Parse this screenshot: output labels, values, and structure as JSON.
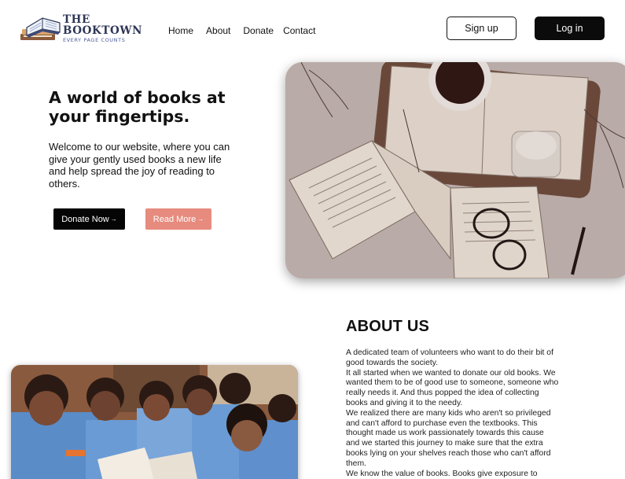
{
  "brand": {
    "title": "THE BOOKTOWN",
    "tagline": "EVERY PAGE COUNTS"
  },
  "nav": {
    "items": [
      "Home",
      "About",
      "Donate",
      "Contact"
    ]
  },
  "auth": {
    "signup_label": "Sign up",
    "login_label": "Log in"
  },
  "hero": {
    "title": "A world of books at your fingertips.",
    "text": "Welcome to our website, where you can give your gently used books a new life and help spread the joy of reading to others.",
    "donate_label": "Donate Now",
    "read_label": "Read More",
    "arrow": "→"
  },
  "about": {
    "title": "ABOUT US",
    "paragraphs": [
      "A dedicated team of volunteers who want to do their bit of good towards the society.",
      "It all started when we wanted to donate our old books. We wanted them to be of good use to someone, someone who really needs it. And thus popped the idea of collecting books and giving it to the needy.",
      "We realized there are many kids who aren't so privileged and can't afford to purchase even the textbooks. This thought made us work passionately towards this cause and we started this journey to make sure that the extra books lying on your shelves reach those who can't afford them.",
      "We know the value of books. Books give exposure to"
    ]
  },
  "colors": {
    "primary_button": "#050505",
    "accent_button": "#e68b7e",
    "brand_navy": "#2e3656"
  }
}
